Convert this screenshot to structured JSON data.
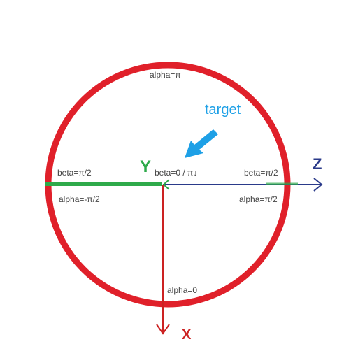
{
  "labels": {
    "alpha_pi": "alpha=π",
    "target": "target",
    "beta_left": "beta=π/2",
    "beta_center": "beta=0 / π↓",
    "beta_right": "beta=π/2",
    "alpha_left": "alpha=-π/2",
    "alpha_right": "alpha=π/2",
    "alpha_zero": "alpha=0"
  },
  "axes": {
    "y": "Y",
    "z": "Z",
    "x": "X"
  },
  "colors": {
    "circle": "#e0202a",
    "y_axis": "#2eaa4a",
    "z_axis": "#2a3a8a",
    "x_axis": "#cc2222",
    "target": "#1ea0e6",
    "label": "#444444"
  }
}
